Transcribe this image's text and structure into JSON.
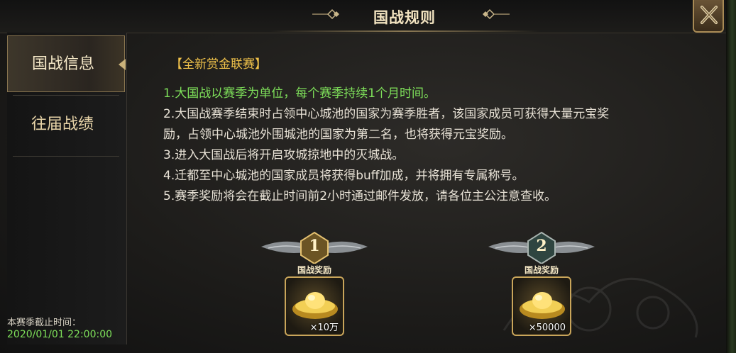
{
  "window": {
    "title": "国战规则",
    "close_icon": "close-x-icon"
  },
  "sidebar": {
    "tabs": [
      {
        "label": "国战信息",
        "active": true
      },
      {
        "label": "往届战绩",
        "active": false
      }
    ],
    "deadline_label": "本赛季截止时间：",
    "deadline_value": "2020/01/01 22:00:00"
  },
  "main": {
    "heading": "【全新赏金联赛】",
    "rules": [
      "1.大国战以赛季为单位，每个赛季持续1个月时间。",
      "2.大国战赛季结束时占领中心城池的国家为赛季胜者，该国家成员可获得大量元宝奖",
      "励，占领中心城池外围城池的国家为第二名，也将获得元宝奖励。",
      "3.进入大国战后将开启攻城掠地中的灭城战。",
      "4.迁都至中心城池的国家成员将获得buff加成，并将拥有专属称号。",
      "5.赛季奖励将会在截止时间前2小时通过邮件发放，请各位主公注意查收。"
    ],
    "rewards": [
      {
        "rank": "1",
        "label": "国战奖励",
        "quantity": "×10万",
        "item_icon": "gold-ingot-icon"
      },
      {
        "rank": "2",
        "label": "国战奖励",
        "quantity": "×50000",
        "item_icon": "gold-ingot-icon"
      }
    ]
  },
  "colors": {
    "heading": "#f0c24a",
    "highlight_rule": "#7ee05a",
    "text": "#e8e2d6",
    "deadline": "#7ee05a",
    "gold_border": "#c9a55a"
  }
}
